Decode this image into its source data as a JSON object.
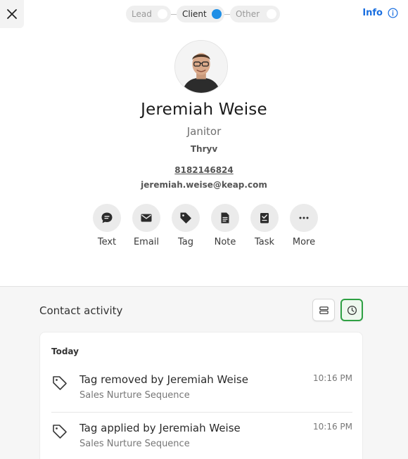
{
  "header": {
    "stages": [
      {
        "label": "Lead",
        "active": false
      },
      {
        "label": "Client",
        "active": true
      },
      {
        "label": "Other",
        "active": false
      }
    ],
    "info_label": "Info"
  },
  "contact": {
    "name": "Jeremiah Weise",
    "job_title": "Janitor",
    "company": "Thryv",
    "phone": "8182146824",
    "email": "jeremiah.weise@keap.com"
  },
  "actions": [
    {
      "label": "Text",
      "icon": "text-bubble-icon"
    },
    {
      "label": "Email",
      "icon": "envelope-icon"
    },
    {
      "label": "Tag",
      "icon": "tag-icon"
    },
    {
      "label": "Note",
      "icon": "note-icon"
    },
    {
      "label": "Task",
      "icon": "task-icon"
    },
    {
      "label": "More",
      "icon": "more-dots-icon"
    }
  ],
  "activity": {
    "title": "Contact activity",
    "day": "Today",
    "items": [
      {
        "title": "Tag removed by Jeremiah Weise",
        "subtitle": "Sales Nurture Sequence",
        "time": "10:16 PM"
      },
      {
        "title": "Tag applied by Jeremiah Weise",
        "subtitle": "Sales Nurture Sequence",
        "time": "10:16 PM"
      }
    ]
  },
  "colors": {
    "accent_blue": "#1a6fe0",
    "active_stage_dot": "#1f8fe6",
    "timeline_selected_border": "#2ea043"
  }
}
